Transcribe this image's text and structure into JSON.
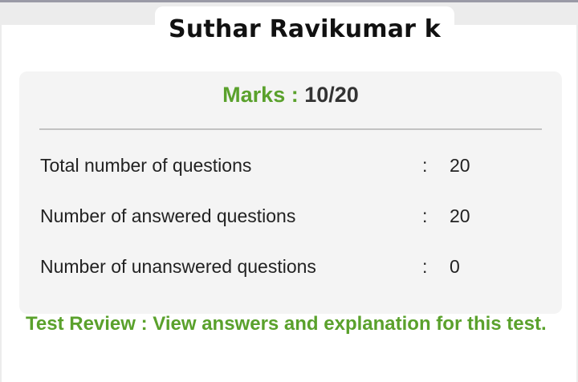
{
  "student": {
    "name": "Suthar Ravikumar k"
  },
  "marks": {
    "label": "Marks :",
    "value": "10/20"
  },
  "stats": [
    {
      "label": "Total number of questions",
      "separator": ":",
      "value": "20"
    },
    {
      "label": "Number of answered questions",
      "separator": ":",
      "value": "20"
    },
    {
      "label": "Number of unanswered questions",
      "separator": ":",
      "value": "0"
    }
  ],
  "review": {
    "link_text": "Test Review : View answers and explanation for this test."
  },
  "colors": {
    "accent_green": "#5aa12c",
    "panel_bg": "#f4f4f4",
    "text_dark": "#222222"
  }
}
